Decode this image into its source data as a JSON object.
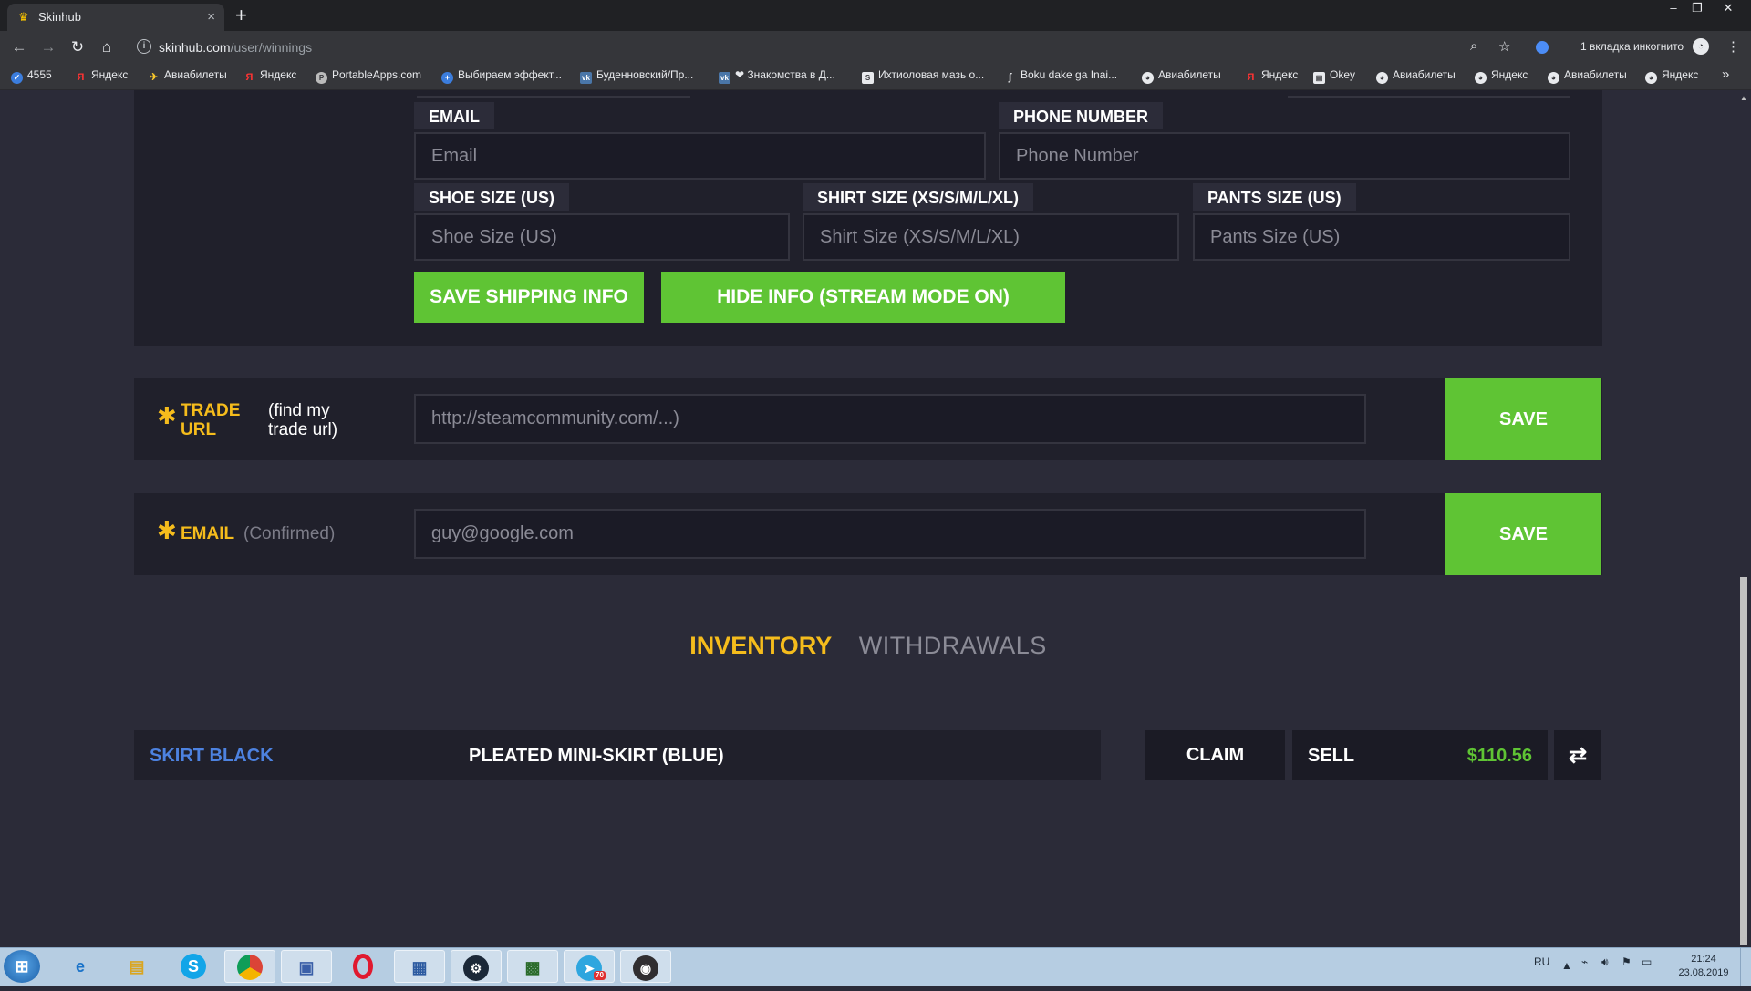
{
  "browser": {
    "tab_title": "Skinhub",
    "tab_close": "×",
    "new_tab": "+",
    "url_host": "skinhub.com",
    "url_path": "/user/winnings",
    "incognito_text": "1 вкладка инкогнито",
    "window_controls": [
      "–",
      "❐",
      "✕"
    ],
    "bookmarks": [
      {
        "label": "4555",
        "icon": "steam-icon"
      },
      {
        "label": "Яндекс",
        "icon": "yandex-icon"
      },
      {
        "label": "Авиабилеты",
        "icon": "plane-icon"
      },
      {
        "label": "Яндекс",
        "icon": "yandex-icon"
      },
      {
        "label": "PortableApps.com",
        "icon": "portableapps-icon"
      },
      {
        "label": "Выбираем эффект...",
        "icon": "blue-circle-icon"
      },
      {
        "label": "Буденновский/Пр...",
        "icon": "vk-icon"
      },
      {
        "label": "❤ Знакомства в Д...",
        "icon": "vk-icon"
      },
      {
        "label": "Ихтиоловая мазь о...",
        "icon": "s-icon"
      },
      {
        "label": "Boku dake ga Inai...",
        "icon": "s-script-icon"
      },
      {
        "label": "Авиабилеты",
        "icon": "globe-icon"
      },
      {
        "label": "Яндекс",
        "icon": "yandex-icon"
      },
      {
        "label": "Okey",
        "icon": "page-icon"
      },
      {
        "label": "Авиабилеты",
        "icon": "globe-icon"
      },
      {
        "label": "Яндекс",
        "icon": "globe-icon"
      },
      {
        "label": "Авиабилеты",
        "icon": "globe-icon"
      },
      {
        "label": "Яндекс",
        "icon": "globe-icon"
      }
    ]
  },
  "shipping": {
    "email_label": "EMAIL",
    "email_placeholder": "Email",
    "phone_label": "PHONE NUMBER",
    "phone_placeholder": "Phone Number",
    "shoe_label": "SHOE SIZE (US)",
    "shoe_placeholder": "Shoe Size (US)",
    "shirt_label": "SHIRT SIZE (XS/S/M/L/XL)",
    "shirt_placeholder": "Shirt Size (XS/S/M/L/XL)",
    "pants_label": "PANTS SIZE (US)",
    "pants_placeholder": "Pants Size (US)",
    "save_button": "SAVE SHIPPING INFO",
    "hide_button": "HIDE INFO (STREAM MODE ON)"
  },
  "trade": {
    "star": "✱",
    "label": "TRADE URL",
    "find_link": "(find my trade url)",
    "placeholder": "http://steamcommunity.com/...)",
    "save": "SAVE"
  },
  "email_section": {
    "star": "✱",
    "label": "EMAIL",
    "status": "(Confirmed)",
    "placeholder": "guy@google.com",
    "save": "SAVE"
  },
  "tabs": {
    "inventory": "INVENTORY",
    "withdrawals": "WITHDRAWALS"
  },
  "item": {
    "brand": "SKIRT BLACK",
    "name": "PLEATED MINI-SKIRT (BLUE)",
    "claim": "CLAIM",
    "sell": "SELL",
    "price": "$110.56",
    "swap_icon": "⇄"
  },
  "taskbar": {
    "lang": "RU",
    "time": "21:24",
    "date": "23.08.2019",
    "apps": [
      "start-button",
      "internet-explorer",
      "file-explorer",
      "skype",
      "chrome",
      "app",
      "opera",
      "control-panel",
      "steam",
      "terminal",
      "telegram",
      "obs"
    ],
    "telegram_badge": "70"
  },
  "colors": {
    "accent_gold": "#f5bc1c",
    "accent_green": "#5fc434",
    "brand_blue": "#4d82e0",
    "page_bg": "#2b2b38",
    "panel_bg": "#20202b"
  }
}
